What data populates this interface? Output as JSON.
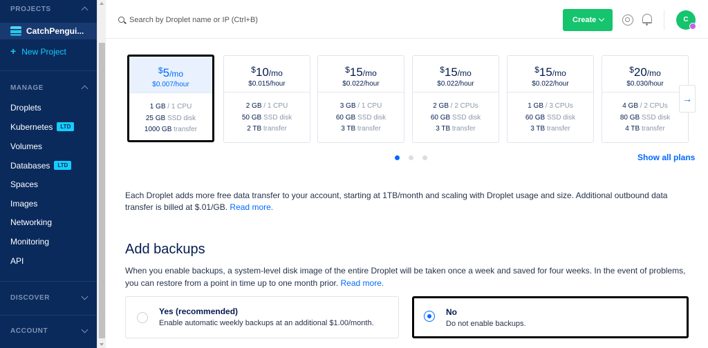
{
  "sidebar": {
    "projects_heading": "PROJECTS",
    "project_name": "CatchPengui...",
    "new_project_label": "New Project",
    "manage_heading": "MANAGE",
    "nav_items": [
      {
        "label": "Droplets",
        "badge": ""
      },
      {
        "label": "Kubernetes",
        "badge": "LTD"
      },
      {
        "label": "Volumes",
        "badge": ""
      },
      {
        "label": "Databases",
        "badge": "LTD"
      },
      {
        "label": "Spaces",
        "badge": ""
      },
      {
        "label": "Images",
        "badge": ""
      },
      {
        "label": "Networking",
        "badge": ""
      },
      {
        "label": "Monitoring",
        "badge": ""
      },
      {
        "label": "API",
        "badge": ""
      }
    ],
    "discover_heading": "DISCOVER",
    "account_heading": "ACCOUNT"
  },
  "topbar": {
    "search_placeholder": "Search by Droplet name or IP (Ctrl+B)",
    "create_label": "Create",
    "avatar_initial": "C"
  },
  "plans": [
    {
      "price": "5",
      "per": "/mo",
      "hourly": "$0.007/hour",
      "memory": "1 GB",
      "cpu": "1 CPU",
      "disk": "25 GB",
      "disk_label": "SSD disk",
      "transfer": "1000 GB",
      "transfer_label": "transfer",
      "selected": true
    },
    {
      "price": "10",
      "per": "/mo",
      "hourly": "$0.015/hour",
      "memory": "2 GB",
      "cpu": "1 CPU",
      "disk": "50 GB",
      "disk_label": "SSD disk",
      "transfer": "2 TB",
      "transfer_label": "transfer",
      "selected": false
    },
    {
      "price": "15",
      "per": "/mo",
      "hourly": "$0.022/hour",
      "memory": "3 GB",
      "cpu": "1 CPU",
      "disk": "60 GB",
      "disk_label": "SSD disk",
      "transfer": "3 TB",
      "transfer_label": "transfer",
      "selected": false
    },
    {
      "price": "15",
      "per": "/mo",
      "hourly": "$0.022/hour",
      "memory": "2 GB",
      "cpu": "2 CPUs",
      "disk": "60 GB",
      "disk_label": "SSD disk",
      "transfer": "3 TB",
      "transfer_label": "transfer",
      "selected": false
    },
    {
      "price": "15",
      "per": "/mo",
      "hourly": "$0.022/hour",
      "memory": "1 GB",
      "cpu": "3 CPUs",
      "disk": "60 GB",
      "disk_label": "SSD disk",
      "transfer": "3 TB",
      "transfer_label": "transfer",
      "selected": false
    },
    {
      "price": "20",
      "per": "/mo",
      "hourly": "$0.030/hour",
      "memory": "4 GB",
      "cpu": "2 CPUs",
      "disk": "80 GB",
      "disk_label": "SSD disk",
      "transfer": "4 TB",
      "transfer_label": "transfer",
      "selected": false
    }
  ],
  "pagination": {
    "active_index": 0,
    "count": 3
  },
  "show_all_plans_label": "Show all plans",
  "transfer_info": {
    "text": "Each Droplet adds more free data transfer to your account, starting at 1TB/month and scaling with Droplet usage and size. Additional outbound data transfer is billed at $.01/GB.",
    "link": "Read more."
  },
  "backups": {
    "heading": "Add backups",
    "description": "When you enable backups, a system-level disk image of the entire Droplet will be taken once a week and saved for four weeks. In the event of problems, you can restore from a point in time up to one month prior.",
    "link": "Read more.",
    "options": [
      {
        "title": "Yes (recommended)",
        "desc": "Enable automatic weekly backups at an additional $1.00/month.",
        "selected": false
      },
      {
        "title": "No",
        "desc": "Do not enable backups.",
        "selected": true
      }
    ]
  },
  "colors": {
    "sidebar_bg": "#0a2a5c",
    "accent_blue": "#0069ff",
    "create_green": "#15c46d",
    "ltd_badge": "#15cdfc"
  },
  "icons": {
    "search": "search-icon",
    "help": "help-lifebuoy-icon",
    "notifications": "bell-icon",
    "next": "arrow-right-icon"
  }
}
